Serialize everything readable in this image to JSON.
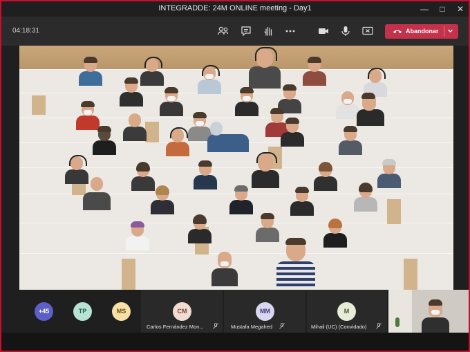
{
  "window": {
    "title": "INTEGRADDE: 24M ONLINE meeting - Day1"
  },
  "toolbar": {
    "timer": "04:18:31",
    "leave_label": "Abandonar"
  },
  "overflow": {
    "count": "+45"
  },
  "avatars": [
    {
      "initials": "TP",
      "color": "#b6e3d4"
    },
    {
      "initials": "MS",
      "color": "#f6e0a8"
    }
  ],
  "participants": [
    {
      "initials": "CM",
      "name": "Carlos Fernández Mon...",
      "color": "#f0dcd2"
    },
    {
      "initials": "MM",
      "name": "Mustafa Megahed",
      "color": "#d9d6ef"
    },
    {
      "initials": "M",
      "name": "Mihail (UC) (Convidado)",
      "color": "#e6ecd6"
    }
  ],
  "colors": {
    "leave": "#c4314b",
    "overflow": "#5b5fc7",
    "window_border": "#c8102e"
  }
}
